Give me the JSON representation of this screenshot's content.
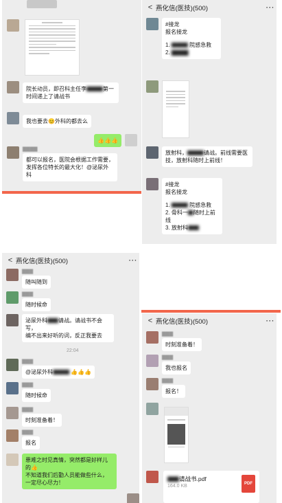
{
  "colors": {
    "chat_bg": "#ededed",
    "bubble": "#ffffff",
    "bubble_self": "#95ec69",
    "divider": "#f2664b",
    "pdf_red": "#e4463b"
  },
  "panel1": {
    "caption_1": "院长动员，即召科主任李",
    "caption_1b": "第一时间递上了请战书",
    "msg_2": "我也要去😊外科的都去么",
    "self_1": "👍👍👍",
    "msg_3_line1": "都可以报名，医院会根据工作需要，",
    "msg_3_line2": "发挥各位特长的最大化！@泌尿外",
    "msg_3_line3": "科"
  },
  "panel2": {
    "title": "燕化信(医技)(500)",
    "jielong": "#接龙",
    "baoming": "报名接龙",
    "item1": "1.",
    "item1b": "院感急救",
    "item2": "2.",
    "msg_fang": "放射科，",
    "msg_qingzhan": "请战。前线需要医",
    "msg_qingzhan2": "技，放射科随时上前线！",
    "jielong2": "#接龙",
    "baoming2": "报名接龙",
    "l1": "1.",
    "l1b": "院感急救",
    "l2": "2. 骨科一",
    "l2b": "随时上前线",
    "l3": "3. 放射科",
    "back": "<",
    "more": "···"
  },
  "panel3": {
    "title": "燕化信(医技)(500)",
    "back": "<",
    "more": "···",
    "m1": "随叫随到",
    "m2": "随时候命",
    "m3_line1": "泌尿外科",
    "m3_line1b": "请战。请战书不会写，",
    "m3_line2": "编不出来好听的词，反正我要去",
    "time": "22:04",
    "m4": "@泌尿外科",
    "m4b": "👍👍👍",
    "m5": "随时候命",
    "m6": "时刻准备着！",
    "m7": "报名",
    "self_l1": "患难之时见真情，突然都是好样儿",
    "self_l2": "的👍",
    "self_l3": "不知道我们后勤人员能做些什么，",
    "self_l4": "一定尽心尽力！"
  },
  "panel4": {
    "title": "燕化信(医技)(500)",
    "back": "<",
    "more": "···",
    "m1": "时刻准备着！",
    "m2": "我也报名",
    "m3": "报名！",
    "file_name": "请战书.pdf",
    "file_size": "164.0 KB",
    "pdf_label": "PDF"
  }
}
